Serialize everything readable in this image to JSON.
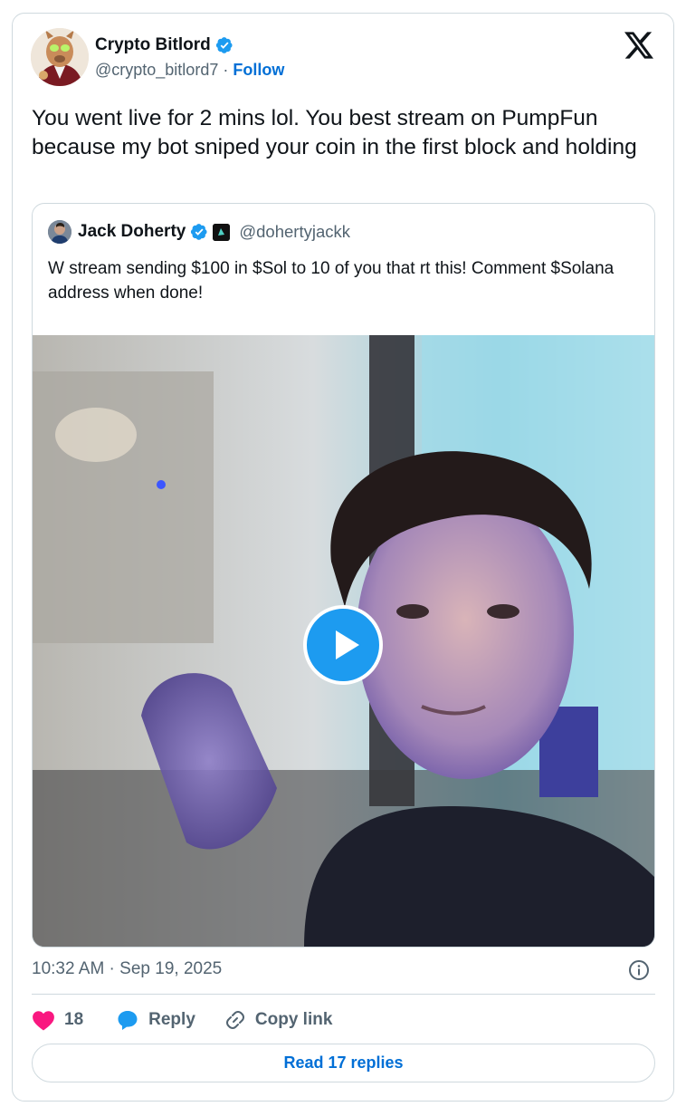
{
  "author": {
    "name": "Crypto Bitlord",
    "handle": "@crypto_bitlord7",
    "separator": "·",
    "follow_label": "Follow",
    "verified": true
  },
  "brand_icon": "x-logo-icon",
  "tweet": {
    "text": "You went live for 2 mins lol. You best stream on PumpFun because my bot sniped your coin in the first block and holding"
  },
  "quoted": {
    "name": "Jack Doherty",
    "handle": "@dohertyjackk",
    "verified": true,
    "text": "W stream sending $100 in $Sol to 10 of you that rt this! Comment $Solana address when done!",
    "media": {
      "type": "video",
      "play_icon": "play-icon"
    }
  },
  "timestamp": "10:32 AM · Sep 19, 2025",
  "actions": {
    "like_count": "18",
    "reply_label": "Reply",
    "copy_link_label": "Copy link"
  },
  "read_replies_label": "Read 17 replies",
  "colors": {
    "accent": "#1d9bf0",
    "link": "#006fd6",
    "like": "#f91880",
    "muted": "#536471",
    "border": "#cfd9de"
  }
}
